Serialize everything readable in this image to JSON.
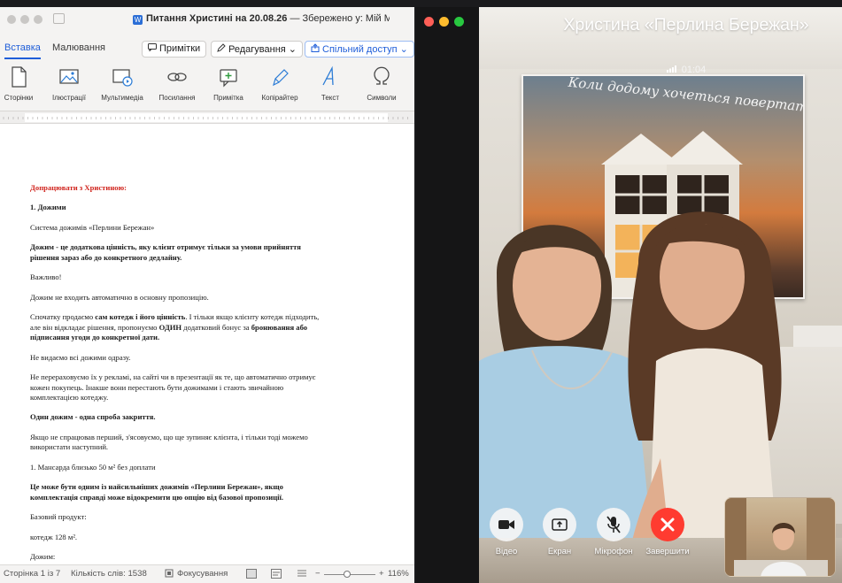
{
  "word": {
    "title_prefix": "Питання Христині на 20.08.26",
    "title_suffix": "— Збережено у: Мій Mac ⌄",
    "tabs": [
      {
        "label": "Вставка",
        "active": true
      },
      {
        "label": "Малювання",
        "active": false
      }
    ],
    "buttons": {
      "notes": "Примітки",
      "editing": "Редагування ⌄",
      "share": "Спільний доступ ⌄"
    },
    "ribbon_groups": [
      {
        "label": "Сторінки",
        "icon": "pages-icon"
      },
      {
        "label": "Ілюстрації",
        "icon": "illustrations-icon"
      },
      {
        "label": "Мультимедіа",
        "icon": "multimedia-icon"
      },
      {
        "label": "Посилання",
        "icon": "link-icon"
      },
      {
        "label": "Примітка",
        "icon": "comment-icon"
      },
      {
        "label": "Копірайтер",
        "icon": "copywriter-icon"
      },
      {
        "label": "Текст",
        "icon": "text-icon"
      },
      {
        "label": "Символи",
        "icon": "symbols-icon"
      }
    ],
    "document": {
      "p01": "Допрацювати з Христиною:",
      "p02": "1. Дожими",
      "p03": "Система дожимів «Перлини Бережан»",
      "p04": "Дожим - це додаткова цінність, яку клієнт отримує тільки за умови прийняття рішення зараз або до конкретного дедлайну.",
      "p05": "Важливо!",
      "p06": "Дожим не входить автоматично в основну пропозицію.",
      "p07a": "Спочатку продаємо ",
      "p07b": "сам котедж і його цінність",
      "p07c": ". І тільки якщо клієнту котедж підходить, але він відкладає рішення, пропонуємо ",
      "p07d": "ОДИН",
      "p07e": " додатковий бонус за ",
      "p07f": "бронювання або підписання угоди до конкретної дати.",
      "p08": "Не видаємо всі дожими одразу.",
      "p09": "Не перераховуємо їх у рекламі, на сайті чи в презентації як те, що автоматично отримує кожен покупець. Інакше вони перестають бути дожимами і стають звичайною комплектацією котеджу.",
      "p10": "Один дожим - одна спроба закриття.",
      "p11": "Якщо не спрацював перший, з'ясовуємо, що ще зупиняє клієнта, і тільки тоді можемо використати наступний.",
      "p12": "1. Мансарда близько 50 м² без доплати",
      "p13": "Це може бути одним із найсильніших дожимів «Перлини Бережан», якщо комплектація справді може відокремити цю опцію від базової пропозиції.",
      "p14": "Базовий продукт:",
      "p15": "котедж 128 м².",
      "p16": "Дожим:"
    },
    "status": {
      "page": "Сторінка 1 із 7",
      "words": "Кількість слів: 1538",
      "focus": "Фокусування",
      "zoom": "116%"
    }
  },
  "call": {
    "caller_name": "Христина «Перлина Бережан»",
    "duration": "01:04",
    "poster_caption": "Коли додому хочеться повертатись...",
    "controls": [
      {
        "label": "Відео",
        "icon": "video-camera-icon"
      },
      {
        "label": "Екран",
        "icon": "screen-share-icon"
      },
      {
        "label": "Мікрофон",
        "icon": "microphone-muted-icon"
      },
      {
        "label": "Завершити",
        "icon": "end-call-icon"
      }
    ],
    "colors": {
      "end_call": "#ff3b30",
      "close": "#ff5f57",
      "minimize": "#febc2e",
      "zoom": "#28c840"
    }
  }
}
